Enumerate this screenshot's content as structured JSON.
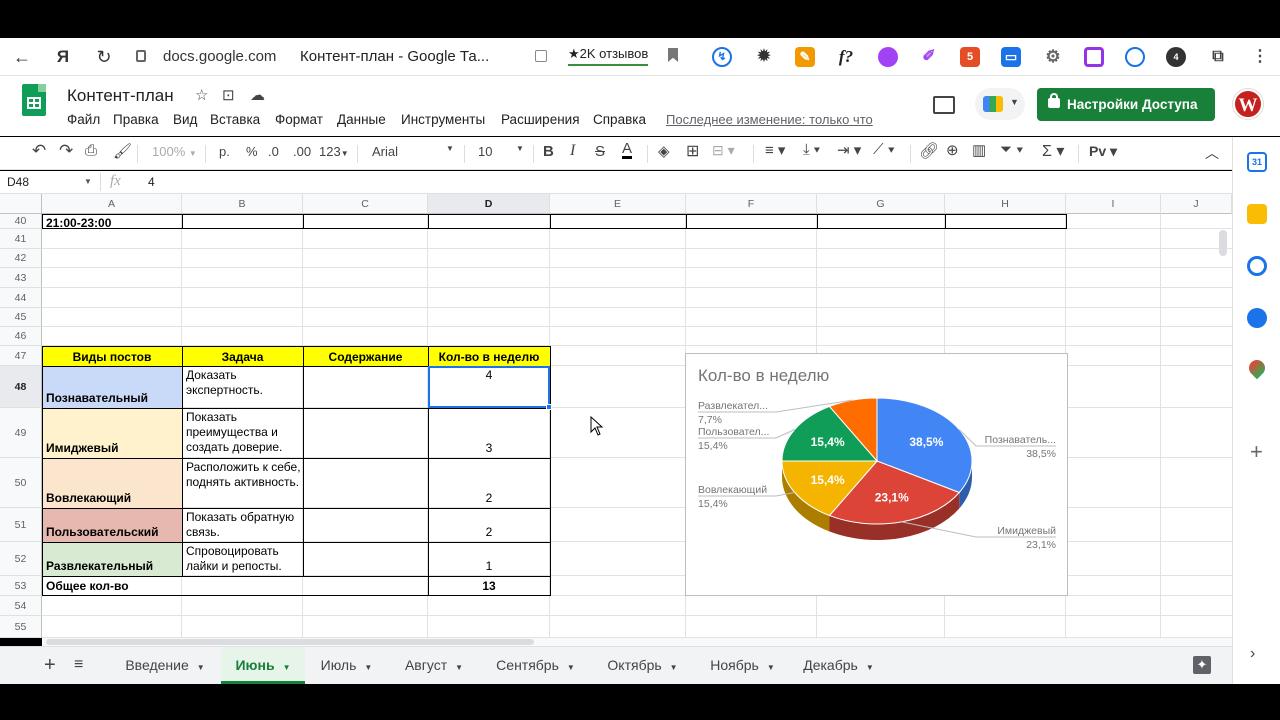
{
  "browser": {
    "url": "docs.google.com",
    "tab_title": "Контент-план - Google Та...",
    "reviews": "2K отзывов"
  },
  "doc": {
    "title": "Контент-план",
    "menu": [
      "Файл",
      "Правка",
      "Вид",
      "Вставка",
      "Формат",
      "Данные",
      "Инструменты",
      "Расширения",
      "Справка"
    ],
    "last_edit": "Последнее изменение: только что",
    "share_label": "Настройки Доступа",
    "avatar_letter": "W"
  },
  "toolbar": {
    "zoom": "100%",
    "currency": "р.",
    "percent": "%",
    "dec_less": ".0",
    "dec_more": ".00",
    "number_format": "123",
    "font": "Arial",
    "font_size": "10"
  },
  "formula_bar": {
    "cell_ref": "D48",
    "fx": "fx",
    "value": "4"
  },
  "columns": [
    "A",
    "B",
    "C",
    "D",
    "E",
    "F",
    "G",
    "H",
    "I",
    "J"
  ],
  "rows": [
    "40",
    "41",
    "42",
    "43",
    "44",
    "45",
    "46",
    "47",
    "48",
    "49",
    "50",
    "51",
    "52",
    "53",
    "54",
    "55"
  ],
  "cells": {
    "a40": "21:00-23:00",
    "header_types": "Виды постов",
    "header_task": "Задача",
    "header_content": "Содержание",
    "header_count": "Кол-во в неделю",
    "r48_type": "Познавательный",
    "r48_task": "Доказать экспертность.",
    "r48_count": "4",
    "r49_type": "Имиджевый",
    "r49_task": "Показать преимущества и создать доверие.",
    "r49_count": "3",
    "r50_type": "Вовлекающий",
    "r50_task": "Расположить к себе, поднять активность.",
    "r50_count": "2",
    "r51_type": "Пользовательский",
    "r51_task": "Показать обратную связь.",
    "r51_count": "2",
    "r52_type": "Развлекательный",
    "r52_task": "Спровоцировать лайки и репосты.",
    "r52_count": "1",
    "total_label": "Общее кол-во",
    "total_value": "13"
  },
  "chart_data": {
    "type": "pie",
    "title": "Кол-во в неделю",
    "categories": [
      "Познавательный",
      "Имиджевый",
      "Вовлекающий",
      "Пользовательский",
      "Развлекательный"
    ],
    "values": [
      4,
      3,
      2,
      2,
      1
    ],
    "percent_labels": [
      "38,5%",
      "23,1%",
      "15,4%",
      "15,4%",
      "7,7%"
    ],
    "legend_names": [
      "Познаватель...",
      "Имиджевый",
      "Вовлекающий",
      "Пользовател...",
      "Развлекател..."
    ],
    "colors": [
      "#4285f4",
      "#db4437",
      "#f4b400",
      "#0f9d58",
      "#ff6d00"
    ],
    "is_3d": true
  },
  "sheet_tabs": [
    "Введение",
    "Июнь",
    "Июль",
    "Август",
    "Сентябрь",
    "Октябрь",
    "Ноябрь",
    "Декабрь"
  ],
  "active_tab": "Июнь"
}
